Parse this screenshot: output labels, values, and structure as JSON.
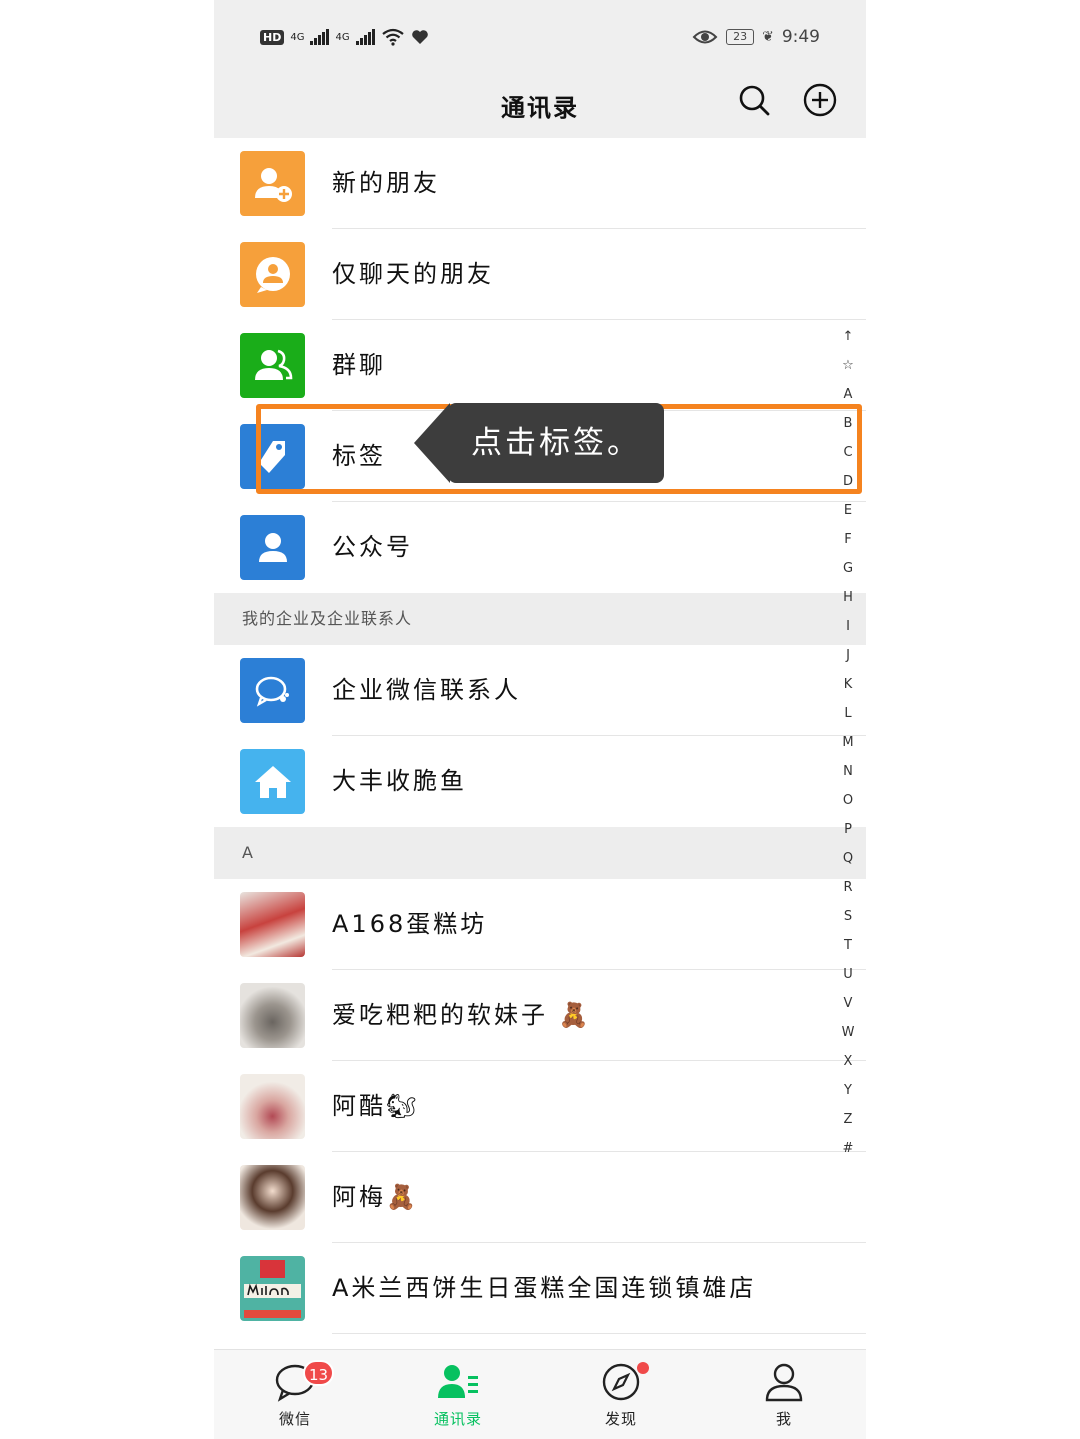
{
  "status_bar": {
    "network_left": "HD",
    "sim1": "4G",
    "sim2": "4G",
    "battery": "23",
    "time": "9:49"
  },
  "header": {
    "title": "通讯录",
    "icons": [
      "search-icon",
      "add-circle-icon"
    ]
  },
  "fixed_entries": [
    {
      "label": "新的朋友",
      "icon": "add-friend-icon",
      "color": "#f6a03b"
    },
    {
      "label": "仅聊天的朋友",
      "icon": "chat-only-friend-icon",
      "color": "#f6a03b"
    },
    {
      "label": "群聊",
      "icon": "group-chat-icon",
      "color": "#1aad19"
    },
    {
      "label": "标签",
      "icon": "tag-icon",
      "color": "#2c7fd6"
    },
    {
      "label": "公众号",
      "icon": "official-account-icon",
      "color": "#2c7fd6"
    }
  ],
  "enterprise_section": {
    "header": "我的企业及企业联系人",
    "items": [
      {
        "label": "企业微信联系人",
        "icon": "wecom-icon",
        "color": "#2c7fd6"
      },
      {
        "label": "大丰收脆鱼",
        "icon": "house-icon",
        "color": "#45b3ee"
      }
    ]
  },
  "contacts_section": {
    "header": "A",
    "contacts": [
      {
        "name": "A168蛋糕坊",
        "suffix": ""
      },
      {
        "name": "爱吃粑粑的软妹子",
        "suffix": "🧸"
      },
      {
        "name": "阿酷",
        "suffix": "🐿"
      },
      {
        "name": "阿梅",
        "suffix": "🧸"
      },
      {
        "name": "A米兰西饼生日蛋糕全国连锁镇雄店",
        "suffix": ""
      }
    ]
  },
  "alpha_index": [
    "↑",
    "☆",
    "A",
    "B",
    "C",
    "D",
    "E",
    "F",
    "G",
    "H",
    "I",
    "J",
    "K",
    "L",
    "M",
    "N",
    "O",
    "P",
    "Q",
    "R",
    "S",
    "T",
    "U",
    "V",
    "W",
    "X",
    "Y",
    "Z",
    "#"
  ],
  "tooltip": {
    "text": "点击标签。"
  },
  "tab_bar": {
    "tabs": [
      {
        "label": "微信",
        "icon": "chat-bubble-icon",
        "badge": "13"
      },
      {
        "label": "通讯录",
        "icon": "contacts-icon",
        "active": true
      },
      {
        "label": "发现",
        "icon": "compass-icon"
      },
      {
        "label": "我",
        "icon": "person-icon"
      }
    ]
  },
  "colors": {
    "accent_green": "#07c160",
    "highlight_orange": "#f5831f",
    "badge_red": "#f04a4a"
  }
}
